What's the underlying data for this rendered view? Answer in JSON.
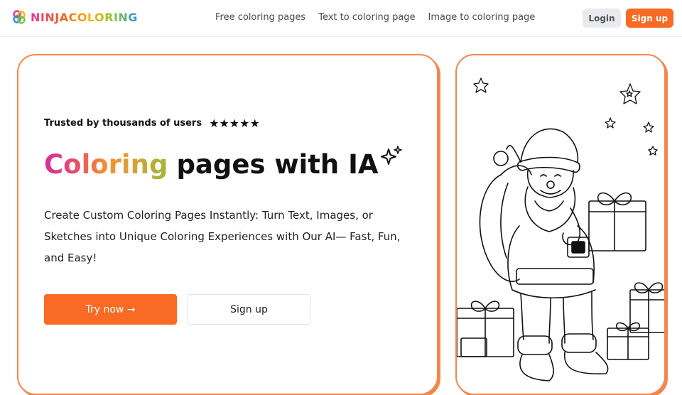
{
  "brand": {
    "name": "NINJACOLORING",
    "logo_icon": "paint-palette-icon"
  },
  "nav": {
    "links": [
      "Free coloring pages",
      "Text to coloring page",
      "Image to coloring page"
    ],
    "login_label": "Login",
    "signup_label": "Sign up"
  },
  "hero": {
    "trusted_text": "Trusted by thousands of users",
    "stars": "★★★★★",
    "rating_stars": 5,
    "headline_gradient": "Coloring",
    "headline_rest": "pages with IA",
    "description": "Create Custom Coloring Pages Instantly: Turn Text, Images, or Sketches into Unique Coloring Experiences with Our AI— Fast, Fun, and Easy!",
    "try_label": "Try now →",
    "signup_label": "Sign up"
  },
  "preview": {
    "icon": "santa-coloring-illustration"
  },
  "colors": {
    "accent": "#f96a24",
    "card_border": "#f2874e",
    "login_bg": "#e8eaed"
  }
}
